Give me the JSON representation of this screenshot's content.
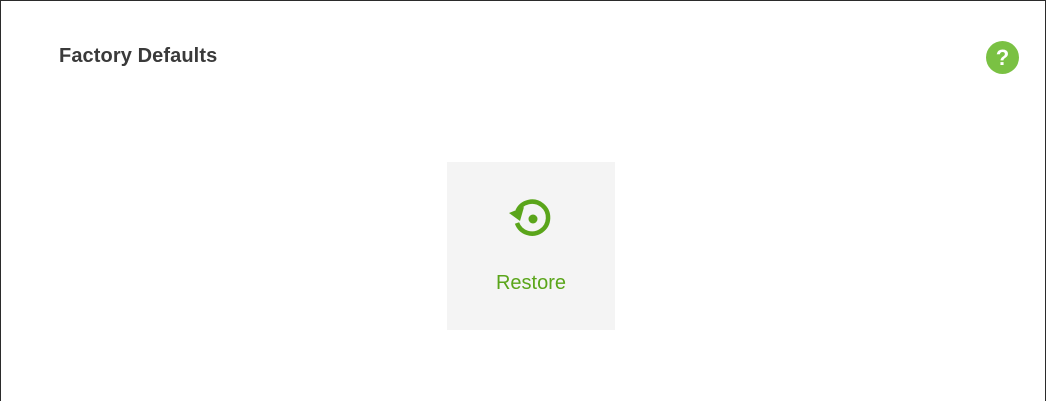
{
  "panel": {
    "title": "Factory Defaults",
    "help_label": "?",
    "help_icon": "help-circle-icon"
  },
  "restore": {
    "label": "Restore",
    "icon": "restore-icon",
    "accent_color": "#5aa51a"
  }
}
